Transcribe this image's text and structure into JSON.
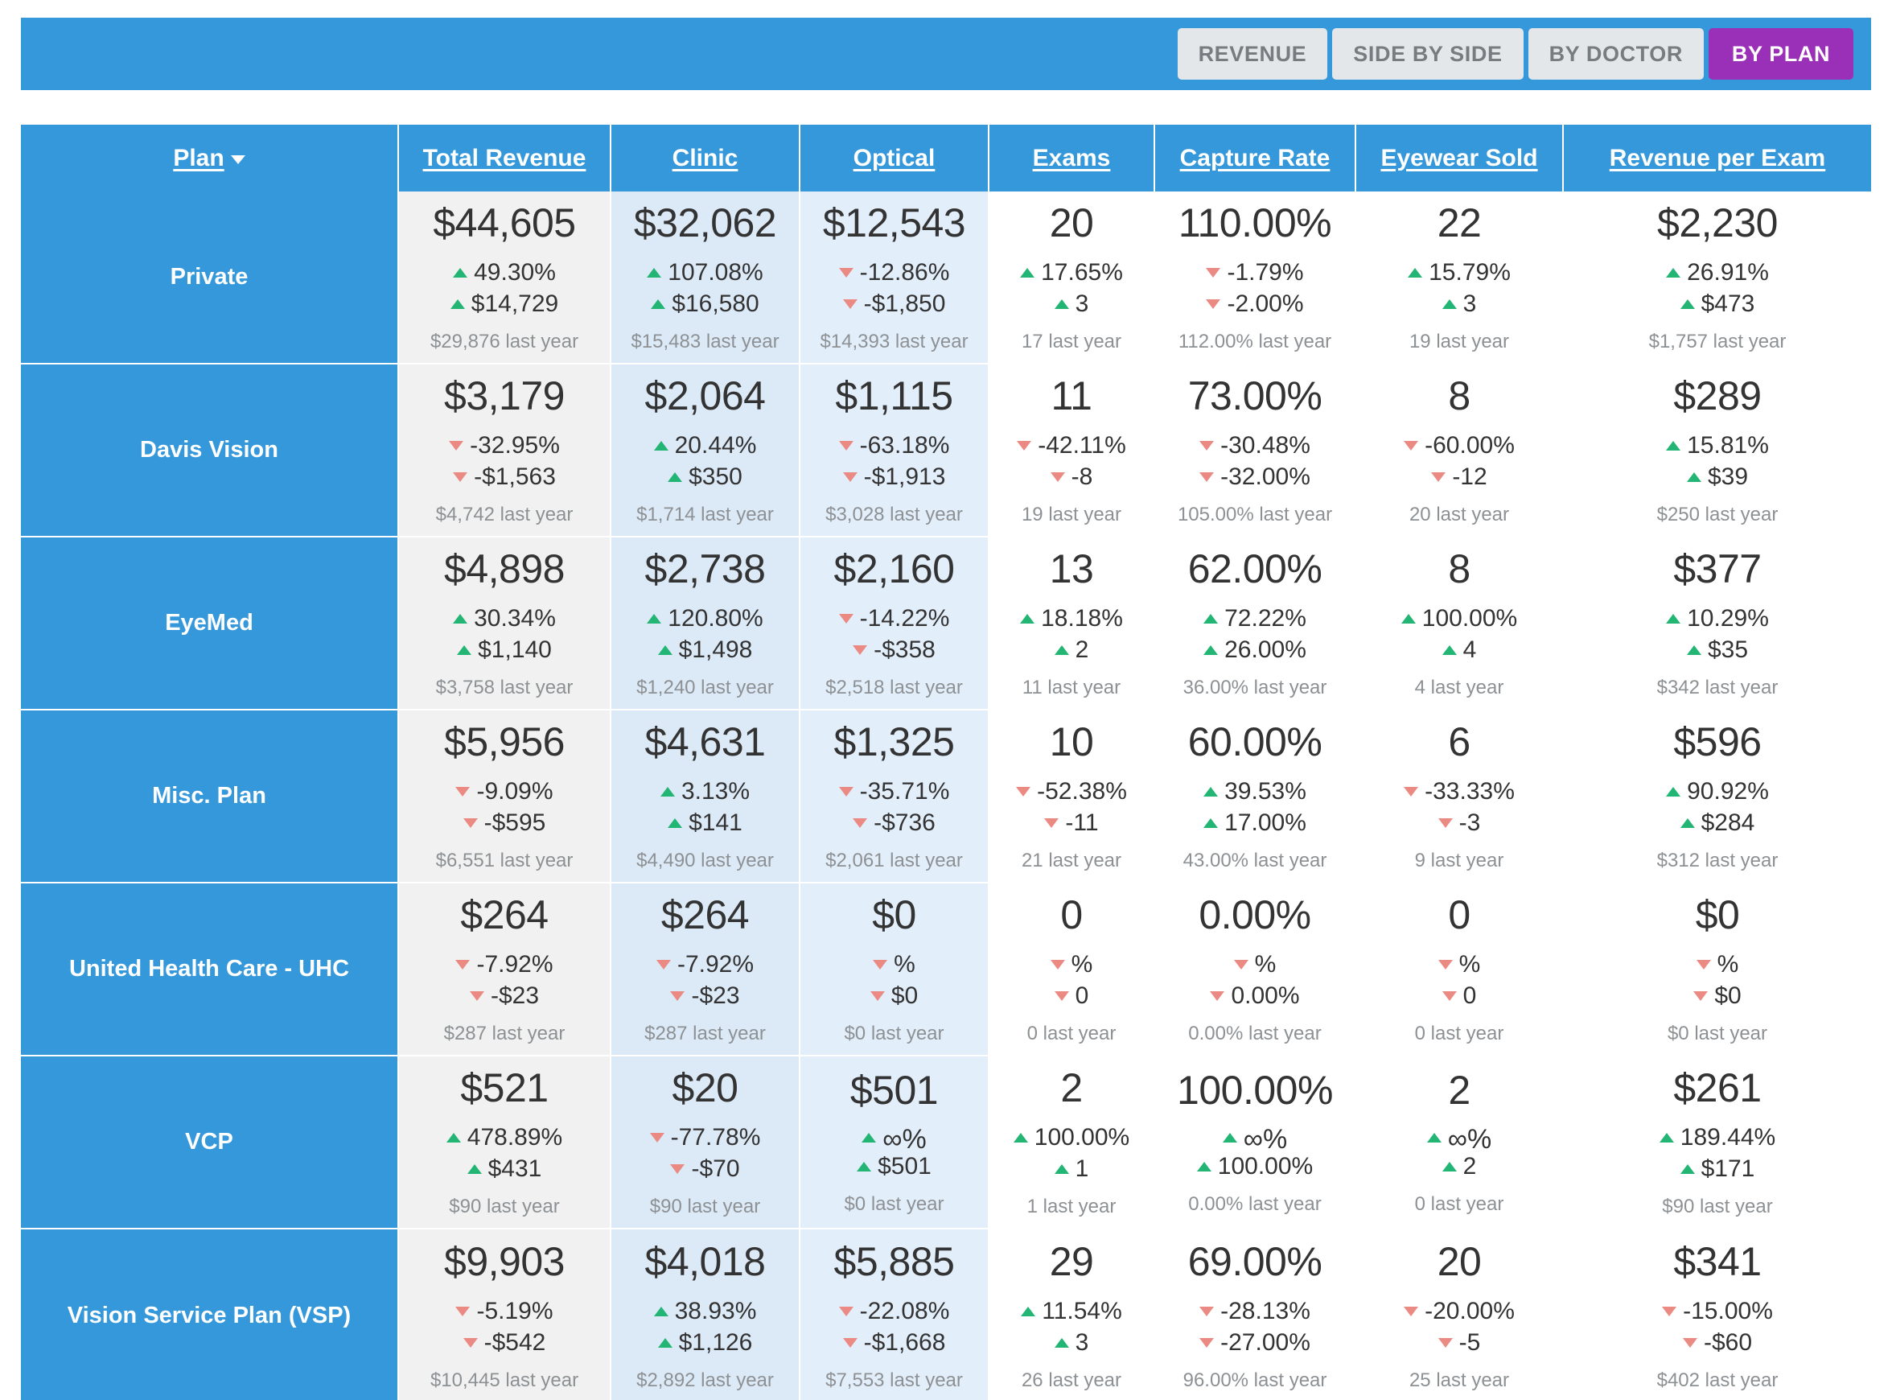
{
  "toolbar": {
    "tabs": [
      {
        "label": "REVENUE",
        "active": false
      },
      {
        "label": "SIDE BY SIDE",
        "active": false
      },
      {
        "label": "BY DOCTOR",
        "active": false
      },
      {
        "label": "BY PLAN",
        "active": true
      }
    ],
    "active_color": "#9b30b8",
    "bar_color": "#3498db"
  },
  "table": {
    "columns": [
      {
        "label": "Plan",
        "sorted": true,
        "sort_dir": "desc"
      },
      {
        "label": "Total Revenue"
      },
      {
        "label": "Clinic"
      },
      {
        "label": "Optical"
      },
      {
        "label": "Exams"
      },
      {
        "label": "Capture Rate"
      },
      {
        "label": "Eyewear Sold"
      },
      {
        "label": "Revenue per Exam"
      }
    ],
    "colors": {
      "up": "#22b573",
      "down": "#ea8a83",
      "header": "#3498db",
      "value": "#333333",
      "muted": "#8d9194"
    },
    "rows": [
      {
        "plan": "Private",
        "cells": [
          {
            "value": "$44,605",
            "pct": "49.30%",
            "pct_dir": "up",
            "abs": "$14,729",
            "abs_dir": "up",
            "last": "$29,876 last year"
          },
          {
            "value": "$32,062",
            "pct": "107.08%",
            "pct_dir": "up",
            "abs": "$16,580",
            "abs_dir": "up",
            "last": "$15,483 last year"
          },
          {
            "value": "$12,543",
            "pct": "-12.86%",
            "pct_dir": "down",
            "abs": "-$1,850",
            "abs_dir": "down",
            "last": "$14,393 last year"
          },
          {
            "value": "20",
            "pct": "17.65%",
            "pct_dir": "up",
            "abs": "3",
            "abs_dir": "up",
            "last": "17 last year"
          },
          {
            "value": "110.00%",
            "pct": "-1.79%",
            "pct_dir": "down",
            "abs": "-2.00%",
            "abs_dir": "down",
            "last": "112.00% last year"
          },
          {
            "value": "22",
            "pct": "15.79%",
            "pct_dir": "up",
            "abs": "3",
            "abs_dir": "up",
            "last": "19 last year"
          },
          {
            "value": "$2,230",
            "pct": "26.91%",
            "pct_dir": "up",
            "abs": "$473",
            "abs_dir": "up",
            "last": "$1,757 last year"
          }
        ]
      },
      {
        "plan": "Davis Vision",
        "cells": [
          {
            "value": "$3,179",
            "pct": "-32.95%",
            "pct_dir": "down",
            "abs": "-$1,563",
            "abs_dir": "down",
            "last": "$4,742 last year"
          },
          {
            "value": "$2,064",
            "pct": "20.44%",
            "pct_dir": "up",
            "abs": "$350",
            "abs_dir": "up",
            "last": "$1,714 last year"
          },
          {
            "value": "$1,115",
            "pct": "-63.18%",
            "pct_dir": "down",
            "abs": "-$1,913",
            "abs_dir": "down",
            "last": "$3,028 last year"
          },
          {
            "value": "11",
            "pct": "-42.11%",
            "pct_dir": "down",
            "abs": "-8",
            "abs_dir": "down",
            "last": "19 last year"
          },
          {
            "value": "73.00%",
            "pct": "-30.48%",
            "pct_dir": "down",
            "abs": "-32.00%",
            "abs_dir": "down",
            "last": "105.00% last year"
          },
          {
            "value": "8",
            "pct": "-60.00%",
            "pct_dir": "down",
            "abs": "-12",
            "abs_dir": "down",
            "last": "20 last year"
          },
          {
            "value": "$289",
            "pct": "15.81%",
            "pct_dir": "up",
            "abs": "$39",
            "abs_dir": "up",
            "last": "$250 last year"
          }
        ]
      },
      {
        "plan": "EyeMed",
        "cells": [
          {
            "value": "$4,898",
            "pct": "30.34%",
            "pct_dir": "up",
            "abs": "$1,140",
            "abs_dir": "up",
            "last": "$3,758 last year"
          },
          {
            "value": "$2,738",
            "pct": "120.80%",
            "pct_dir": "up",
            "abs": "$1,498",
            "abs_dir": "up",
            "last": "$1,240 last year"
          },
          {
            "value": "$2,160",
            "pct": "-14.22%",
            "pct_dir": "down",
            "abs": "-$358",
            "abs_dir": "down",
            "last": "$2,518 last year"
          },
          {
            "value": "13",
            "pct": "18.18%",
            "pct_dir": "up",
            "abs": "2",
            "abs_dir": "up",
            "last": "11 last year"
          },
          {
            "value": "62.00%",
            "pct": "72.22%",
            "pct_dir": "up",
            "abs": "26.00%",
            "abs_dir": "up",
            "last": "36.00% last year"
          },
          {
            "value": "8",
            "pct": "100.00%",
            "pct_dir": "up",
            "abs": "4",
            "abs_dir": "up",
            "last": "4 last year"
          },
          {
            "value": "$377",
            "pct": "10.29%",
            "pct_dir": "up",
            "abs": "$35",
            "abs_dir": "up",
            "last": "$342 last year"
          }
        ]
      },
      {
        "plan": "Misc. Plan",
        "cells": [
          {
            "value": "$5,956",
            "pct": "-9.09%",
            "pct_dir": "down",
            "abs": "-$595",
            "abs_dir": "down",
            "last": "$6,551 last year"
          },
          {
            "value": "$4,631",
            "pct": "3.13%",
            "pct_dir": "up",
            "abs": "$141",
            "abs_dir": "up",
            "last": "$4,490 last year"
          },
          {
            "value": "$1,325",
            "pct": "-35.71%",
            "pct_dir": "down",
            "abs": "-$736",
            "abs_dir": "down",
            "last": "$2,061 last year"
          },
          {
            "value": "10",
            "pct": "-52.38%",
            "pct_dir": "down",
            "abs": "-11",
            "abs_dir": "down",
            "last": "21 last year"
          },
          {
            "value": "60.00%",
            "pct": "39.53%",
            "pct_dir": "up",
            "abs": "17.00%",
            "abs_dir": "up",
            "last": "43.00% last year"
          },
          {
            "value": "6",
            "pct": "-33.33%",
            "pct_dir": "down",
            "abs": "-3",
            "abs_dir": "down",
            "last": "9 last year"
          },
          {
            "value": "$596",
            "pct": "90.92%",
            "pct_dir": "up",
            "abs": "$284",
            "abs_dir": "up",
            "last": "$312 last year"
          }
        ]
      },
      {
        "plan": "United Health Care - UHC",
        "cells": [
          {
            "value": "$264",
            "pct": "-7.92%",
            "pct_dir": "down",
            "abs": "-$23",
            "abs_dir": "down",
            "last": "$287 last year"
          },
          {
            "value": "$264",
            "pct": "-7.92%",
            "pct_dir": "down",
            "abs": "-$23",
            "abs_dir": "down",
            "last": "$287 last year"
          },
          {
            "value": "$0",
            "pct": "%",
            "pct_dir": "down",
            "abs": "$0",
            "abs_dir": "down",
            "last": "$0 last year"
          },
          {
            "value": "0",
            "pct": "%",
            "pct_dir": "down",
            "abs": "0",
            "abs_dir": "down",
            "last": "0 last year"
          },
          {
            "value": "0.00%",
            "pct": "%",
            "pct_dir": "down",
            "abs": "0.00%",
            "abs_dir": "down",
            "last": "0.00% last year"
          },
          {
            "value": "0",
            "pct": "%",
            "pct_dir": "down",
            "abs": "0",
            "abs_dir": "down",
            "last": "0 last year"
          },
          {
            "value": "$0",
            "pct": "%",
            "pct_dir": "down",
            "abs": "$0",
            "abs_dir": "down",
            "last": "$0 last year"
          }
        ]
      },
      {
        "plan": "VCP",
        "cells": [
          {
            "value": "$521",
            "pct": "478.89%",
            "pct_dir": "up",
            "abs": "$431",
            "abs_dir": "up",
            "last": "$90 last year"
          },
          {
            "value": "$20",
            "pct": "-77.78%",
            "pct_dir": "down",
            "abs": "-$70",
            "abs_dir": "down",
            "last": "$90 last year"
          },
          {
            "value": "$501",
            "pct": "∞%",
            "pct_dir": "up",
            "abs": "$501",
            "abs_dir": "up",
            "last": "$0 last year"
          },
          {
            "value": "2",
            "pct": "100.00%",
            "pct_dir": "up",
            "abs": "1",
            "abs_dir": "up",
            "last": "1 last year"
          },
          {
            "value": "100.00%",
            "pct": "∞%",
            "pct_dir": "up",
            "abs": "100.00%",
            "abs_dir": "up",
            "last": "0.00% last year"
          },
          {
            "value": "2",
            "pct": "∞%",
            "pct_dir": "up",
            "abs": "2",
            "abs_dir": "up",
            "last": "0 last year"
          },
          {
            "value": "$261",
            "pct": "189.44%",
            "pct_dir": "up",
            "abs": "$171",
            "abs_dir": "up",
            "last": "$90 last year"
          }
        ]
      },
      {
        "plan": "Vision Service Plan (VSP)",
        "cells": [
          {
            "value": "$9,903",
            "pct": "-5.19%",
            "pct_dir": "down",
            "abs": "-$542",
            "abs_dir": "down",
            "last": "$10,445 last year"
          },
          {
            "value": "$4,018",
            "pct": "38.93%",
            "pct_dir": "up",
            "abs": "$1,126",
            "abs_dir": "up",
            "last": "$2,892 last year"
          },
          {
            "value": "$5,885",
            "pct": "-22.08%",
            "pct_dir": "down",
            "abs": "-$1,668",
            "abs_dir": "down",
            "last": "$7,553 last year"
          },
          {
            "value": "29",
            "pct": "11.54%",
            "pct_dir": "up",
            "abs": "3",
            "abs_dir": "up",
            "last": "26 last year"
          },
          {
            "value": "69.00%",
            "pct": "-28.13%",
            "pct_dir": "down",
            "abs": "-27.00%",
            "abs_dir": "down",
            "last": "96.00% last year"
          },
          {
            "value": "20",
            "pct": "-20.00%",
            "pct_dir": "down",
            "abs": "-5",
            "abs_dir": "down",
            "last": "25 last year"
          },
          {
            "value": "$341",
            "pct": "-15.00%",
            "pct_dir": "down",
            "abs": "-$60",
            "abs_dir": "down",
            "last": "$402 last year"
          }
        ]
      }
    ]
  }
}
